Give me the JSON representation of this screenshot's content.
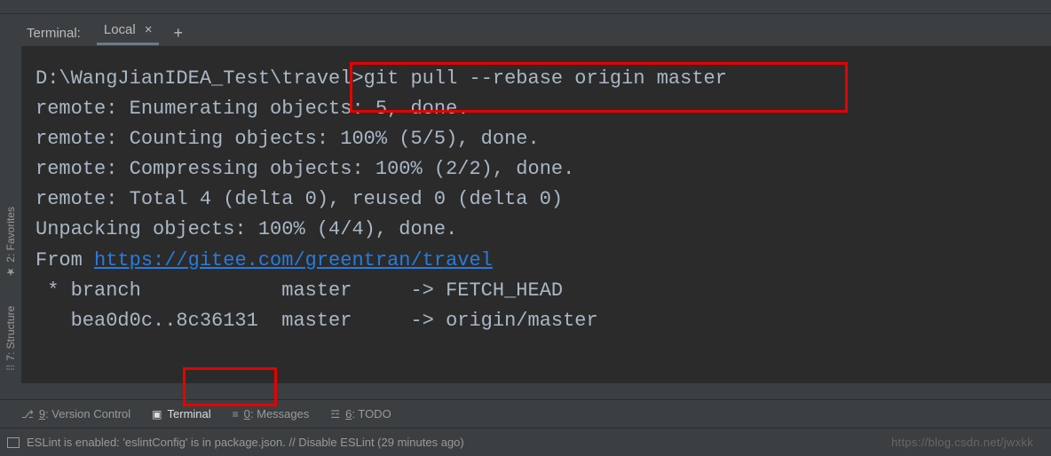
{
  "header": {
    "terminal_label": "Terminal:",
    "tab_label": "Local"
  },
  "terminal": {
    "prompt": "D:\\WangJianIDEA_Test\\trave",
    "command_part1": "l>git pull --rebase origin master",
    "lines": [
      "remote: Enumerating objects: 5, done.",
      "remote: Counting objects: 100% (5/5), done.",
      "remote: Compressing objects: 100% (2/2), done.",
      "remote: Total 4 (delta 0), reused 0 (delta 0)",
      "Unpacking objects: 100% (4/4), done."
    ],
    "from_prefix": "From ",
    "from_link": "https://gitee.com/greentran/travel",
    "branch_line": " * branch            master     -> FETCH_HEAD",
    "commit_line": "   bea0d0c..8c36131  master     -> origin/master"
  },
  "sidebar": {
    "favorites": "2: Favorites",
    "structure": "7: Structure"
  },
  "toolbar": {
    "version_control": "9: Version Control",
    "terminal": "Terminal",
    "messages": "0: Messages",
    "todo": "6: TODO"
  },
  "status": {
    "message": "ESLint is enabled: 'eslintConfig' is in package.json. // Disable ESLint (29 minutes ago)",
    "watermark": "https://blog.csdn.net/jwxkk"
  }
}
